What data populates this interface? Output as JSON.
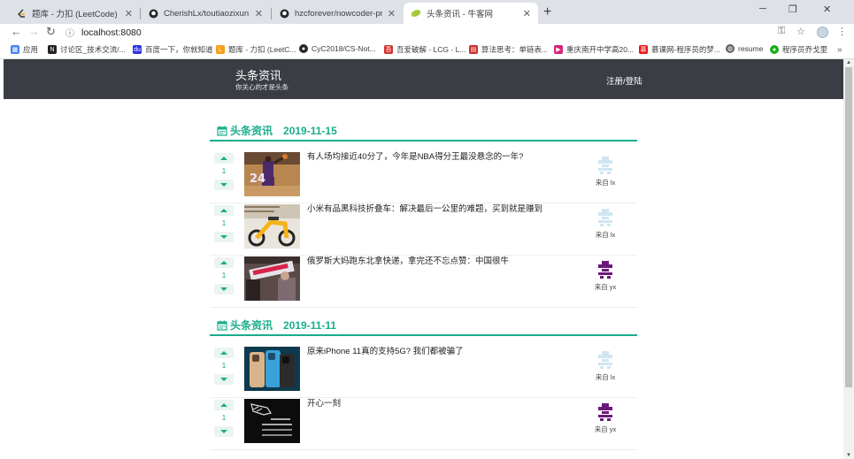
{
  "browser": {
    "tabs": [
      {
        "title": "题库 - 力扣 (LeetCode) 全球极客",
        "active": false,
        "favicon": "leetcode-icon"
      },
      {
        "title": "CherishLx/toutiaozixun",
        "active": false,
        "favicon": "github-icon"
      },
      {
        "title": "hzcforever/nowcoder-project",
        "active": false,
        "favicon": "github-icon"
      },
      {
        "title": "头条资讯 - 牛客网",
        "active": true,
        "favicon": "nowcoder-icon"
      }
    ],
    "new_tab": "+",
    "url": "localhost:8080",
    "bookmarks": [
      {
        "label": "应用",
        "icon": "apps-grid-icon",
        "color": "#4285f4"
      },
      {
        "label": "讨论区_技术交流/...",
        "icon": "nowcoder-icon",
        "color": "#222222"
      },
      {
        "label": "百度一下，你就知道",
        "icon": "baidu-icon",
        "color": "#2932e1"
      },
      {
        "label": "题库 - 力扣 (LeetC...",
        "icon": "leetcode-icon",
        "color": "#f89f1b"
      },
      {
        "label": "CyC2018/CS-Not...",
        "icon": "github-icon",
        "color": "#24292e"
      },
      {
        "label": "吾爱破解 - LCG - L...",
        "icon": "52pojie-icon",
        "color": "#d0312d"
      },
      {
        "label": "算法思考：单链表...",
        "icon": "blog-icon",
        "color": "#c9302c"
      },
      {
        "label": "重庆南开中学高20...",
        "icon": "school-icon",
        "color": "#d4237a"
      },
      {
        "label": "慕课网-程序员的梦...",
        "icon": "imooc-icon",
        "color": "#f01414"
      },
      {
        "label": "resume",
        "icon": "globe-icon",
        "color": "#5f6368"
      },
      {
        "label": "程序员乔戈里",
        "icon": "wechat-icon",
        "color": "#1aad19"
      }
    ]
  },
  "site": {
    "title": "头条资讯",
    "subtitle": "你关心的才是头条",
    "login": "注册/登陆",
    "accent": "#1aad8b",
    "header_bg": "#3a3e44"
  },
  "days": [
    {
      "label": "头条资讯",
      "date": "2019-11-15",
      "items": [
        {
          "votes": "1",
          "title": "有人场均接近40分了，今年是NBA得分王最没悬念的一年?",
          "author": "来自 lx",
          "avatar": "light"
        },
        {
          "votes": "1",
          "title": "小米有品黑科技折叠车：解决最后一公里的难题，买到就是赚到",
          "author": "来自 lx",
          "avatar": "light"
        },
        {
          "votes": "1",
          "title": "俄罗斯大妈跑东北拿快递，拿完还不忘点赞：中国很牛",
          "author": "来自 yx",
          "avatar": "purple"
        }
      ]
    },
    {
      "label": "头条资讯",
      "date": "2019-11-11",
      "items": [
        {
          "votes": "1",
          "title": "原来iPhone 11真的支持5G? 我们都被骗了",
          "author": "来自 lx",
          "avatar": "light"
        },
        {
          "votes": "1",
          "title": "开心一刻",
          "author": "来自 yx",
          "avatar": "purple"
        }
      ]
    }
  ]
}
